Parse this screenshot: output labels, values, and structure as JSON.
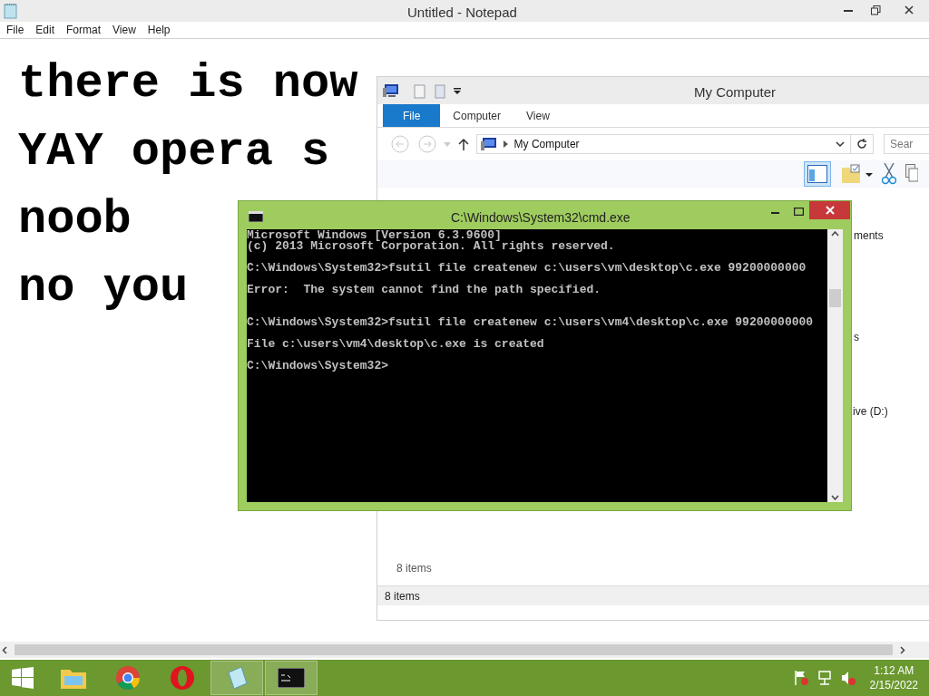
{
  "notepad": {
    "title": "Untitled - Notepad",
    "menu": [
      "File",
      "Edit",
      "Format",
      "View",
      "Help"
    ],
    "lines": [
      "there is now",
      "YAY opera s",
      "noob",
      "no you"
    ]
  },
  "explorer": {
    "title": "My Computer",
    "ribbon_tabs": [
      {
        "label": "File",
        "selected": true
      },
      {
        "label": "Computer",
        "selected": false
      },
      {
        "label": "View",
        "selected": false
      }
    ],
    "address": "My Computer",
    "search": {
      "placeholder": "Sear"
    },
    "fragments": [
      "ments",
      "s",
      "ive (D:)"
    ],
    "item_count": "8 items",
    "status_bar": "8 items"
  },
  "cmd": {
    "title": "C:\\Windows\\System32\\cmd.exe",
    "lines": [
      {
        "kind": "line",
        "text": "Microsoft Windows [Version 6.3.9600]"
      },
      {
        "kind": "line",
        "text": "(c) 2013 Microsoft Corporation. All rights reserved."
      },
      {
        "kind": "spaced",
        "text": "C:\\Windows\\System32>fsutil file createnew c:\\users\\vm\\desktop\\c.exe 99200000000"
      },
      {
        "kind": "spaced",
        "text": "Error:  The system cannot find the path specified."
      },
      {
        "kind": "double_spaced",
        "text": "C:\\Windows\\System32>fsutil file createnew c:\\users\\vm4\\desktop\\c.exe 99200000000"
      },
      {
        "kind": "spaced",
        "text": "File c:\\users\\vm4\\desktop\\c.exe is created"
      },
      {
        "kind": "spaced",
        "text": "C:\\Windows\\System32>"
      }
    ]
  },
  "taskbar": {
    "apps": [
      {
        "kind": "explorer",
        "active": false
      },
      {
        "kind": "chrome",
        "active": false
      },
      {
        "kind": "opera",
        "active": false
      },
      {
        "kind": "notepad",
        "active": true
      },
      {
        "kind": "cmd",
        "active": true
      }
    ],
    "time": "1:12 AM",
    "date": "2/15/2022"
  }
}
